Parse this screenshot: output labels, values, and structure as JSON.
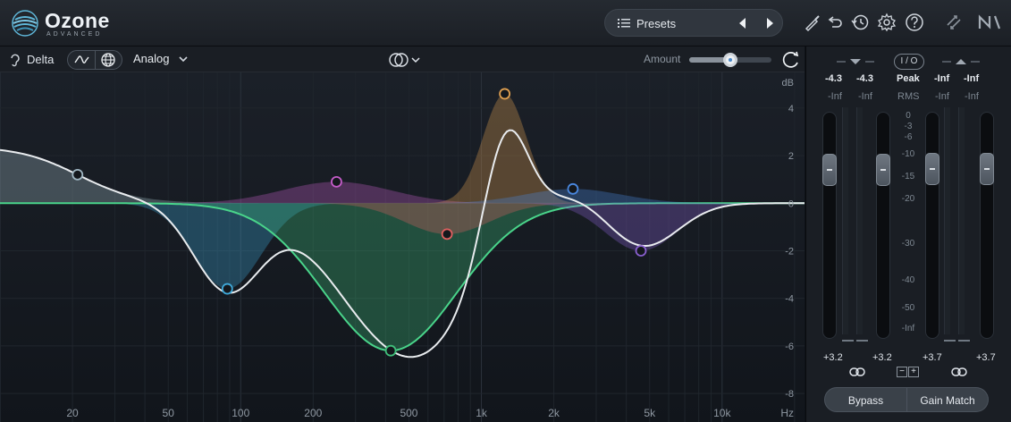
{
  "header": {
    "brand_name": "Ozone",
    "brand_sub": "ADVANCED",
    "presets_label": "Presets",
    "icons": [
      "brush-icon",
      "undo-icon",
      "history-icon",
      "gear-icon",
      "help-icon",
      "swap-icon",
      "ni-logo-icon"
    ]
  },
  "toolbar": {
    "delta_label": "Delta",
    "mode_label": "Analog",
    "amount_label": "Amount",
    "amount_value": 0.5
  },
  "graph": {
    "db_unit": "dB",
    "db_ticks": [
      {
        "value": 4,
        "label": "4"
      },
      {
        "value": 2,
        "label": "2"
      },
      {
        "value": 0,
        "label": "0"
      },
      {
        "value": -2,
        "label": "-2"
      },
      {
        "value": -4,
        "label": "-4"
      },
      {
        "value": -6,
        "label": "-6"
      },
      {
        "value": -8,
        "label": "-8"
      }
    ],
    "freq_unit": "Hz",
    "freq_ticks": [
      {
        "hz": 20,
        "label": "20"
      },
      {
        "hz": 50,
        "label": "50"
      },
      {
        "hz": 100,
        "label": "100"
      },
      {
        "hz": 200,
        "label": "200"
      },
      {
        "hz": 500,
        "label": "500"
      },
      {
        "hz": 1000,
        "label": "1k"
      },
      {
        "hz": 2000,
        "label": "2k"
      },
      {
        "hz": 5000,
        "label": "5k"
      },
      {
        "hz": 10000,
        "label": "10k"
      }
    ],
    "bands": [
      {
        "id": 1,
        "type": "lowshelf",
        "hz": 21,
        "gain": 2.4,
        "width": 0.35,
        "color": "#9fb6c2"
      },
      {
        "id": 2,
        "type": "bell",
        "hz": 88,
        "gain": -3.6,
        "width": 0.28,
        "color": "#3fa8d8"
      },
      {
        "id": 3,
        "type": "bell",
        "hz": 250,
        "gain": 0.9,
        "width": 0.45,
        "color": "#c45cc8"
      },
      {
        "id": 4,
        "type": "bell",
        "hz": 420,
        "gain": -6.2,
        "width": 0.55,
        "color": "#3fbf7a"
      },
      {
        "id": 5,
        "type": "bell",
        "hz": 720,
        "gain": -1.3,
        "width": 0.35,
        "color": "#e06060"
      },
      {
        "id": 6,
        "type": "bell",
        "hz": 1250,
        "gain": 4.6,
        "width": 0.18,
        "color": "#e0a050"
      },
      {
        "id": 7,
        "type": "bell",
        "hz": 2400,
        "gain": 0.6,
        "width": 0.4,
        "color": "#4a88e0"
      },
      {
        "id": 8,
        "type": "bell",
        "hz": 4600,
        "gain": -2.0,
        "width": 0.3,
        "color": "#8a60d0"
      }
    ],
    "freq_min": 10,
    "freq_max": 22000,
    "db_min": -9.2,
    "db_max": 5.5
  },
  "meters": {
    "in_peak_l": "-4.3",
    "in_peak_r": "-4.3",
    "in_rms_l": "-Inf",
    "in_rms_r": "-Inf",
    "io_label": "I / O",
    "peak_label": "Peak",
    "rms_label": "RMS",
    "out_peak_l": "-Inf",
    "out_peak_r": "-Inf",
    "out_rms_l": "-Inf",
    "out_rms_r": "-Inf",
    "scale": [
      "0",
      "-3",
      "-6",
      "-10",
      "-15",
      "-20",
      "-30",
      "-40",
      "-50",
      "-Inf"
    ],
    "in_gain_l": "+3.2",
    "in_gain_r": "+3.2",
    "out_gain_l": "+3.7",
    "out_gain_r": "+3.7",
    "minus_label": "−",
    "plus_label": "+",
    "bypass_label": "Bypass",
    "gain_match_label": "Gain Match"
  }
}
